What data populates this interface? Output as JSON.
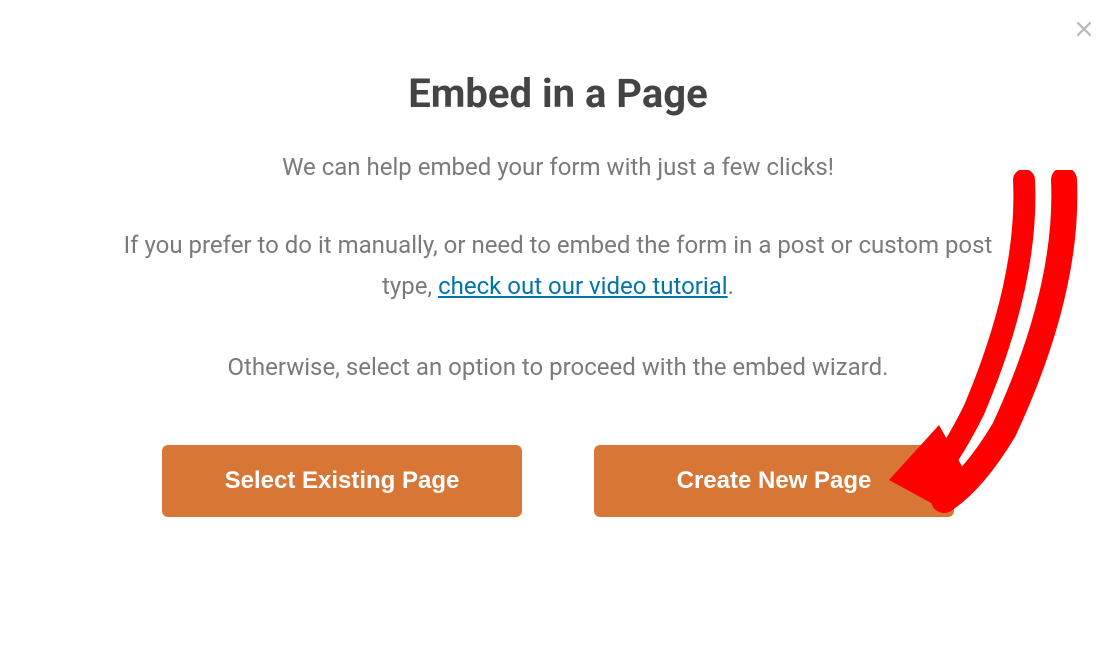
{
  "modal": {
    "title": "Embed in a Page",
    "subtitle": "We can help embed your form with just a few clicks!",
    "para1_before": "If you prefer to do it manually, or need to embed the form in a post or custom post type, ",
    "para1_link": "check out our video tutorial",
    "para1_after": ".",
    "para2": "Otherwise, select an option to proceed with the embed wizard.",
    "buttons": {
      "select_existing": "Select Existing Page",
      "create_new": "Create New Page"
    }
  },
  "colors": {
    "button_bg": "#d87636",
    "link": "#0073aa",
    "text_muted": "#7a7a7a",
    "heading": "#444444",
    "annotation": "#ff0000"
  }
}
